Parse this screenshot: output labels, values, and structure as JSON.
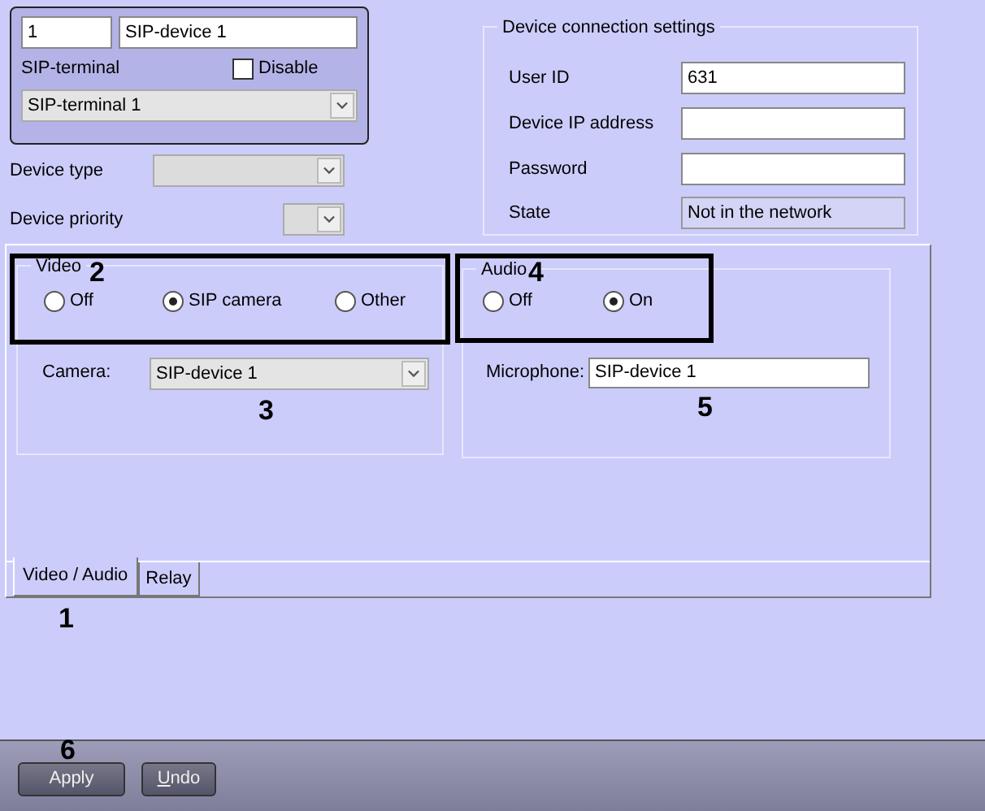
{
  "device": {
    "number": "1",
    "name": "SIP-device 1",
    "terminal_label": "SIP-terminal",
    "disable": {
      "label": "Disable",
      "checked": false
    },
    "terminal": "SIP-terminal 1"
  },
  "device_type": {
    "label": "Device type"
  },
  "device_priority": {
    "label": "Device priority"
  },
  "connection": {
    "title": "Device connection settings",
    "fields": [
      {
        "label": "User ID",
        "value": "631",
        "readonly": false
      },
      {
        "label": "Device IP address",
        "readonly": false
      },
      {
        "label": "Password",
        "readonly": false
      },
      {
        "label": "State",
        "value": "Not in the network",
        "readonly": true
      }
    ]
  },
  "tab_panel": {
    "video": {
      "title": "Video",
      "highlighted": true,
      "callout": "2",
      "options": [
        {
          "label": "Off",
          "selected": false
        },
        {
          "label": "SIP camera",
          "selected": true
        },
        {
          "label": "Other",
          "selected": false
        }
      ],
      "camera_label": "Camera:",
      "camera": "SIP-device 1",
      "camera_callout": "3"
    },
    "audio": {
      "title": "Audio",
      "highlighted": true,
      "callout": "4",
      "options": [
        {
          "label": "Off",
          "selected": false
        },
        {
          "label": "On",
          "selected": true
        }
      ],
      "microphone_label": "Microphone:",
      "microphone": "SIP-device 1",
      "microphone_callout": "5"
    },
    "tabs": [
      {
        "label": "Video / Audio",
        "selected": true
      },
      {
        "label": "Relay",
        "selected": false
      }
    ],
    "tabs_callout": "1"
  },
  "buttons": [
    {
      "label": "Apply",
      "mnemonic_underlined": false
    },
    {
      "label": "Undo",
      "mnemonic_underlined": true
    }
  ],
  "buttons_callout": "6"
}
